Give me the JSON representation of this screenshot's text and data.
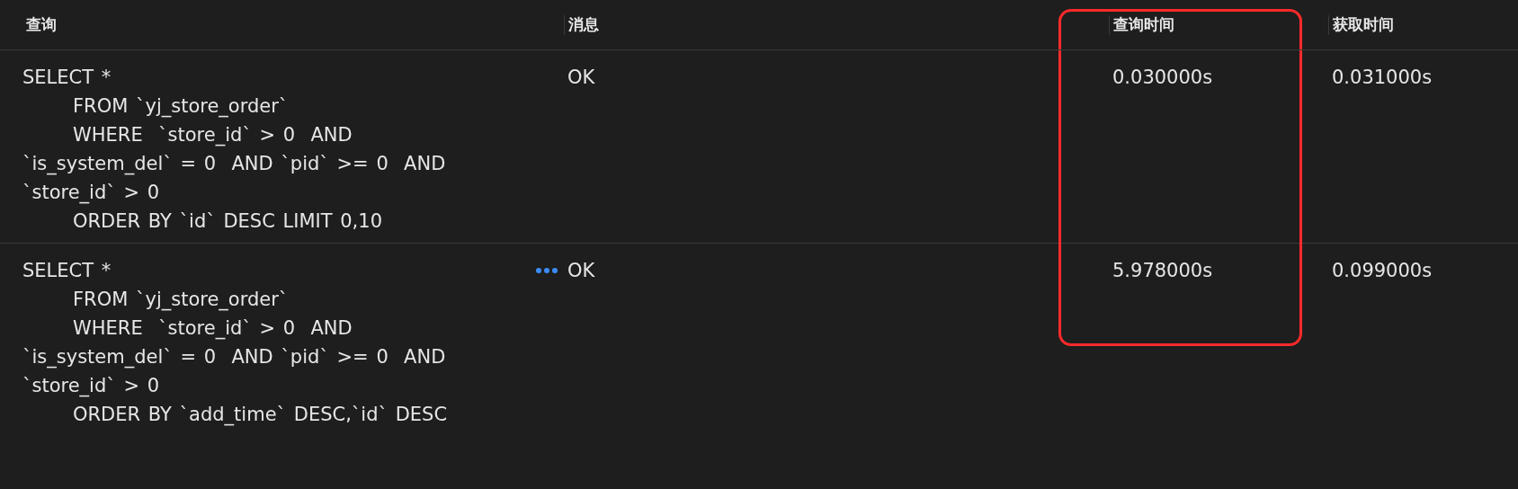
{
  "columns": [
    {
      "label": "查询",
      "highlighted": false
    },
    {
      "label": "消息",
      "highlighted": false
    },
    {
      "label": "查询时间",
      "highlighted": true
    },
    {
      "label": "获取时间",
      "highlighted": false
    }
  ],
  "rows": [
    {
      "query": [
        {
          "text": "SELECT *",
          "indented": false
        },
        {
          "text": "FROM `yj_store_order`",
          "indented": true
        },
        {
          "text": "WHERE  `store_id` > 0  AND",
          "indented": true
        },
        {
          "text": "`is_system_del` = 0  AND `pid` >= 0  AND",
          "indented": false
        },
        {
          "text": "`store_id` > 0",
          "indented": false
        },
        {
          "text": "ORDER BY `id` DESC LIMIT 0,10",
          "indented": true
        }
      ],
      "more": false,
      "message": "OK",
      "query_time": "0.030000s",
      "fetch_time": "0.031000s"
    },
    {
      "query": [
        {
          "text": "SELECT *",
          "indented": false
        },
        {
          "text": "FROM `yj_store_order`",
          "indented": true
        },
        {
          "text": "WHERE  `store_id` > 0  AND",
          "indented": true
        },
        {
          "text": "`is_system_del` = 0  AND `pid` >= 0  AND",
          "indented": false
        },
        {
          "text": "`store_id` > 0",
          "indented": false
        },
        {
          "text": "ORDER BY `add_time` DESC,`id` DESC",
          "indented": true
        }
      ],
      "more": true,
      "message": "OK",
      "query_time": "5.978000s",
      "fetch_time": "0.099000s"
    }
  ]
}
